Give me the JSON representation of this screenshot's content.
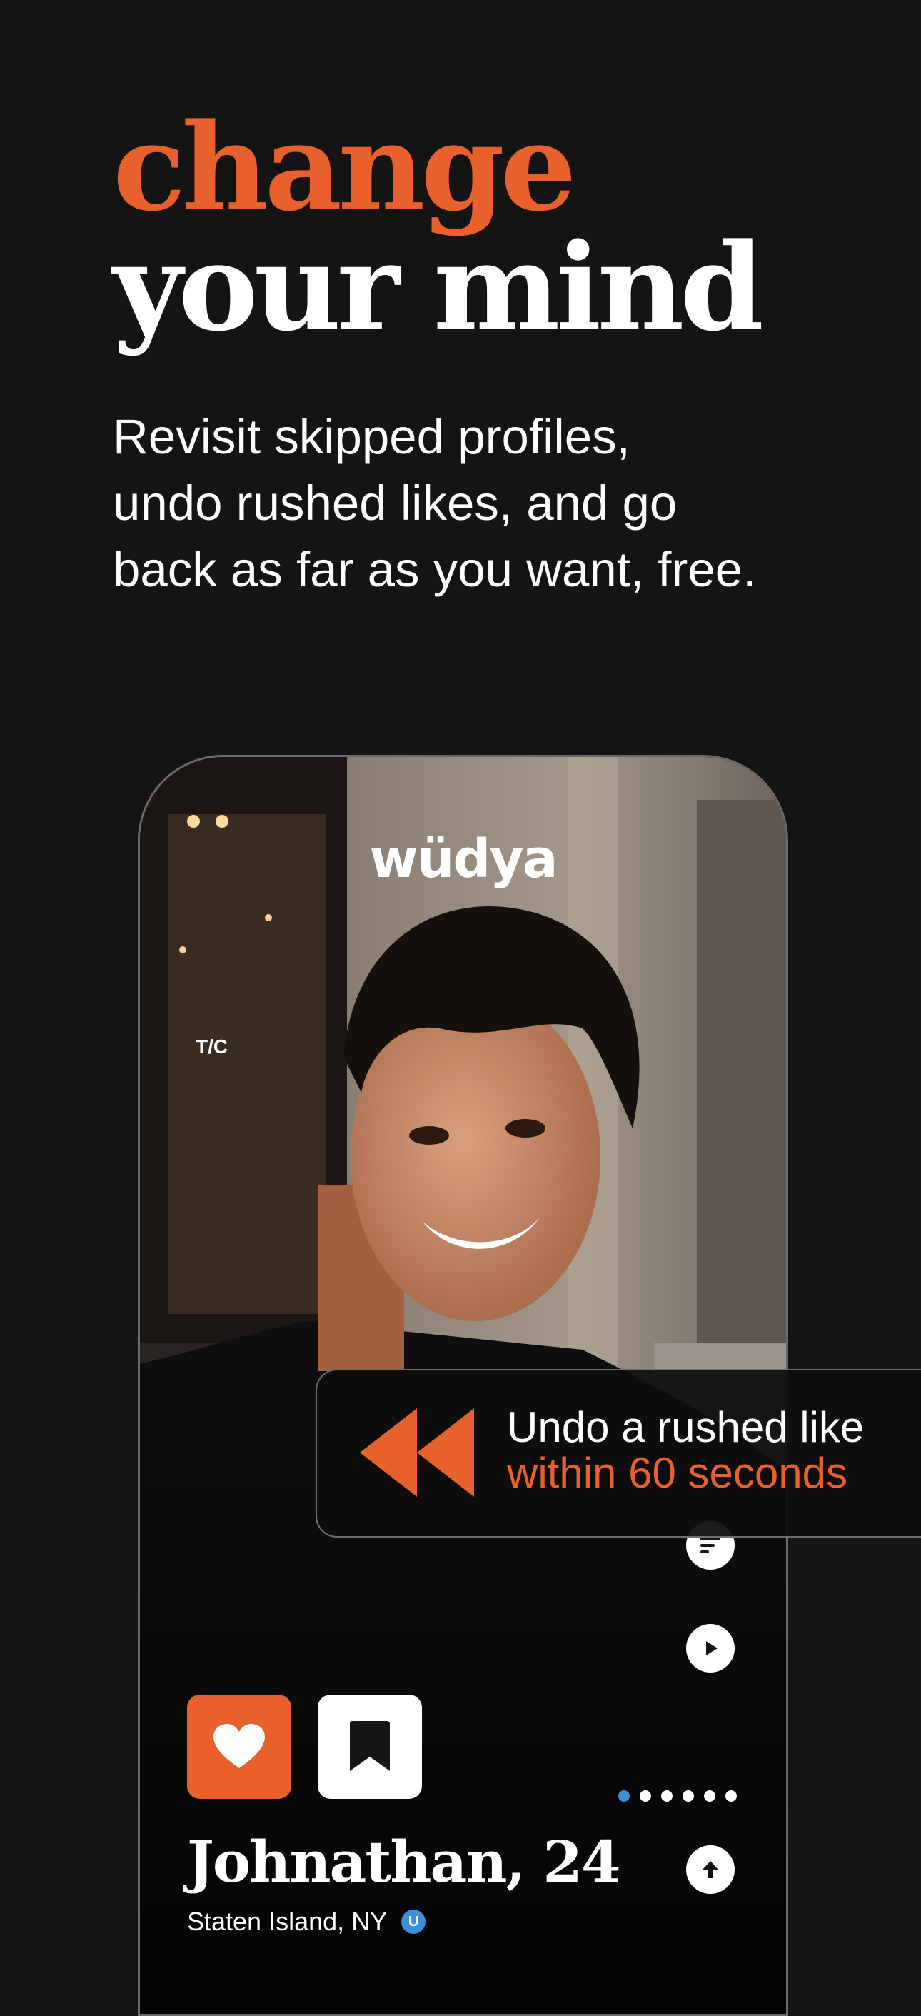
{
  "headline": {
    "line1": "change",
    "line2": "your mind"
  },
  "subtitle": {
    "lines": [
      "Revisit skipped profiles,",
      "undo rushed likes, and go",
      "back as far as you want, free."
    ]
  },
  "app": {
    "logo": "wüdya",
    "profile": {
      "name": "Johnathan, 24",
      "location": "Staten Island, NY"
    },
    "verified_glyph": "U",
    "photo_dots": {
      "count": 6,
      "active_index": 0
    },
    "side_icons": [
      "prompt-icon",
      "play-icon",
      "arrow-up-icon"
    ],
    "actions": [
      "heart-icon",
      "bookmark-icon"
    ]
  },
  "undo_card": {
    "line1": "Undo a rushed like",
    "line2": "within 60 seconds"
  },
  "colors": {
    "accent": "#E8602C",
    "background": "#141414",
    "verified": "#3C8FD9"
  }
}
